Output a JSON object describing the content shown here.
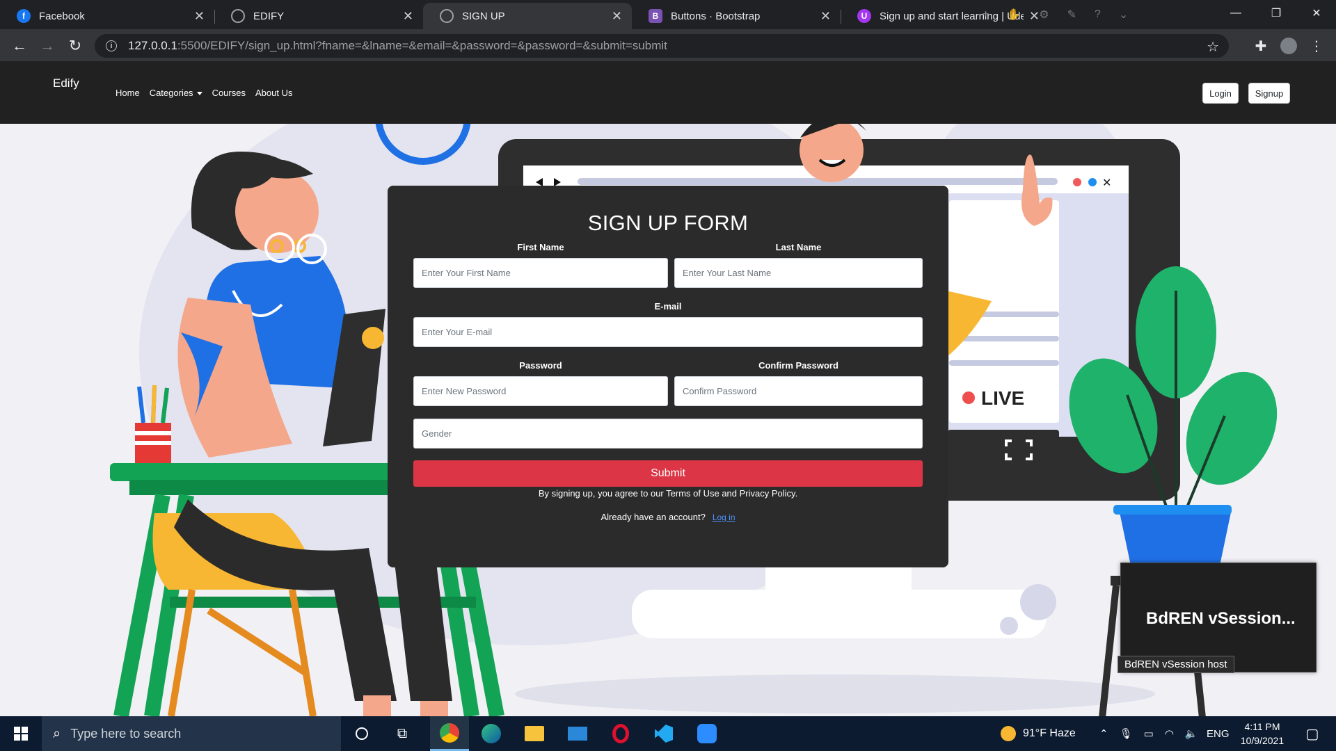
{
  "browser": {
    "tabs": [
      {
        "title": "Facebook",
        "icon": "facebook-icon",
        "color": "#1877f2"
      },
      {
        "title": "EDIFY",
        "icon": "globe-icon",
        "color": "#9aa0a6"
      },
      {
        "title": "SIGN UP",
        "icon": "globe-icon",
        "color": "#9aa0a6",
        "active": true
      },
      {
        "title": "Buttons · Bootstrap",
        "icon": "bootstrap-icon",
        "color": "#7952b3",
        "glyph": "B"
      },
      {
        "title": "Sign up and start learning | Udemy",
        "icon": "udemy-icon",
        "color": "#a435f0",
        "glyph": "U"
      }
    ],
    "url_host": "127.0.0.1",
    "url_rest": ":5500/EDIFY/sign_up.html?fname=&lname=&email=&password=&password=&submit=submit"
  },
  "site": {
    "brand": "Edify",
    "nav": [
      "Home",
      "Categories",
      "Courses",
      "About Us"
    ],
    "login_label": "Login",
    "signup_label": "Signup",
    "hero_live": "LIVE"
  },
  "form": {
    "title": "SIGN UP FORM",
    "first_name_label": "First Name",
    "first_name_placeholder": "Enter Your First Name",
    "last_name_label": "Last Name",
    "last_name_placeholder": "Enter Your Last Name",
    "email_label": "E-mail",
    "email_placeholder": "Enter Your E-mail",
    "password_label": "Password",
    "password_placeholder": "Enter New Password",
    "confirm_label": "Confirm Password",
    "confirm_placeholder": "Confirm Password",
    "gender_placeholder": "Gender",
    "submit_label": "Submit",
    "terms": "By signing up, you agree to our Terms of Use and Privacy Policy.",
    "have_account": "Already have an account?",
    "login_link": "Log in"
  },
  "popup": {
    "title": "BdREN  vSession...",
    "tooltip": "BdREN vSession host"
  },
  "taskbar": {
    "search_placeholder": "Type here to search",
    "weather": "91°F  Haze",
    "language": "ENG",
    "time": "4:11 PM",
    "date": "10/9/2021"
  },
  "colors": {
    "accent_red": "#dc3545",
    "form_bg": "#2b2b2c",
    "navbar_bg": "#212121"
  }
}
